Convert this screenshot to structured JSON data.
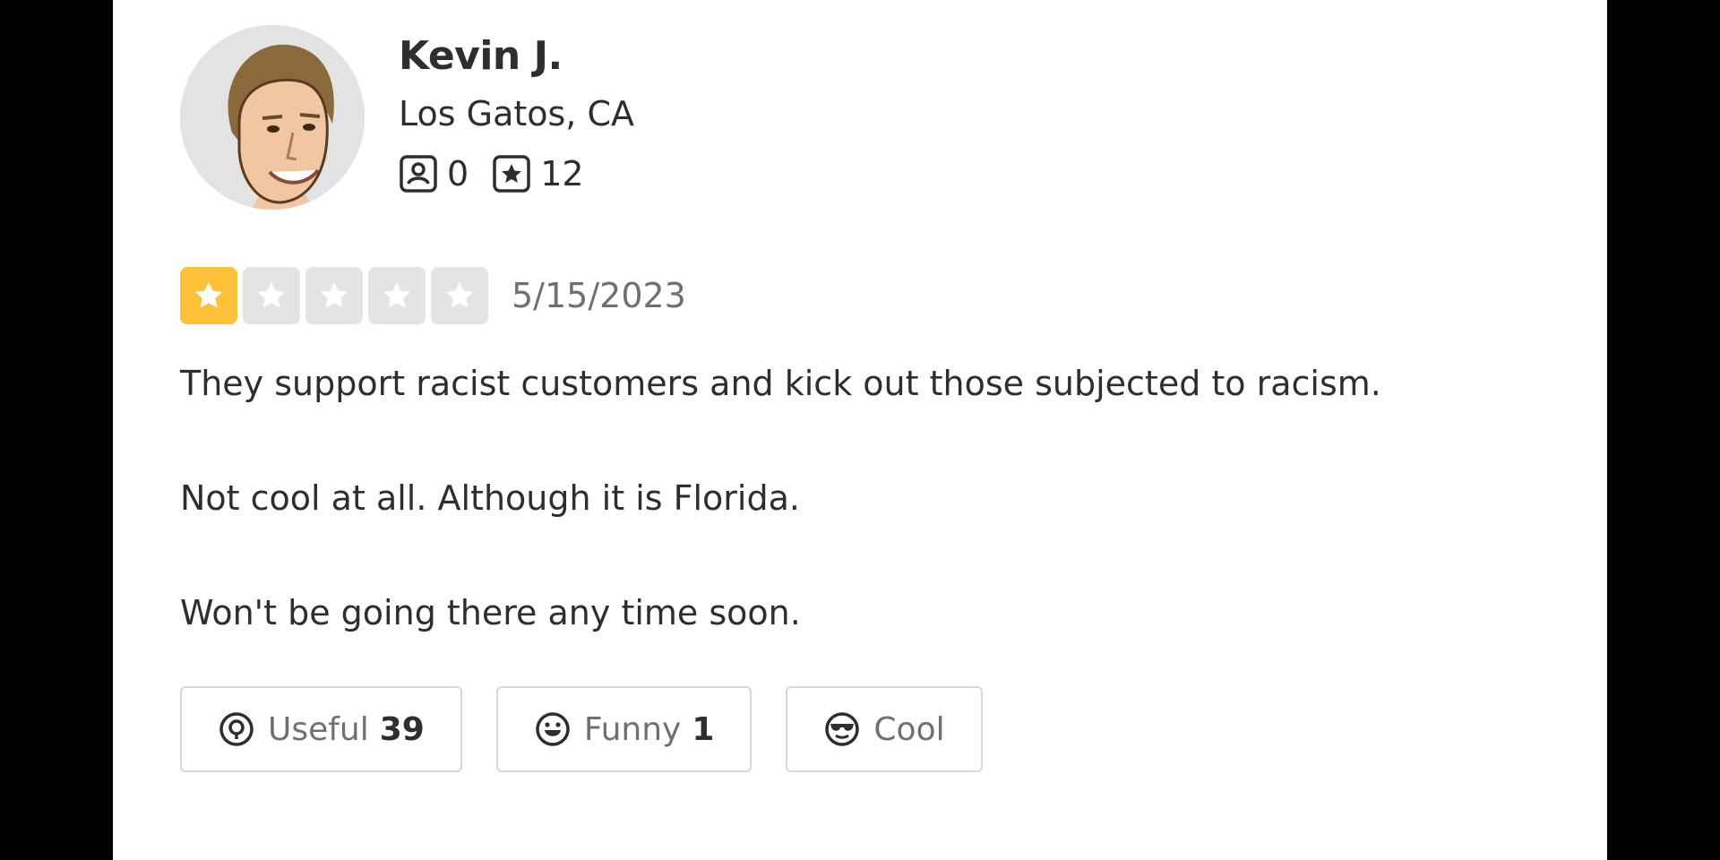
{
  "review": {
    "user": {
      "name": "Kevin J.",
      "location": "Los Gatos, CA",
      "friends_count": "0",
      "reviews_count": "12",
      "avatar_icon": "user-avatar-portrait"
    },
    "rating": 1,
    "rating_max": 5,
    "date": "5/15/2023",
    "paragraphs": [
      "They support racist customers and kick out those subjected to racism.",
      "Not cool at all. Although it is Florida.",
      "Won't be going there any time soon."
    ],
    "actions": {
      "useful": {
        "label": "Useful",
        "count": "39",
        "icon": "useful-icon"
      },
      "funny": {
        "label": "Funny",
        "count": "1",
        "icon": "funny-face-icon"
      },
      "cool": {
        "label": "Cool",
        "count": "",
        "icon": "cool-sunglasses-icon"
      }
    }
  },
  "colors": {
    "star_filled": "#ffc13a",
    "star_empty": "#e4e4e4",
    "text": "#2d2e2f",
    "muted": "#6e7072",
    "border": "#d8d8d8"
  }
}
